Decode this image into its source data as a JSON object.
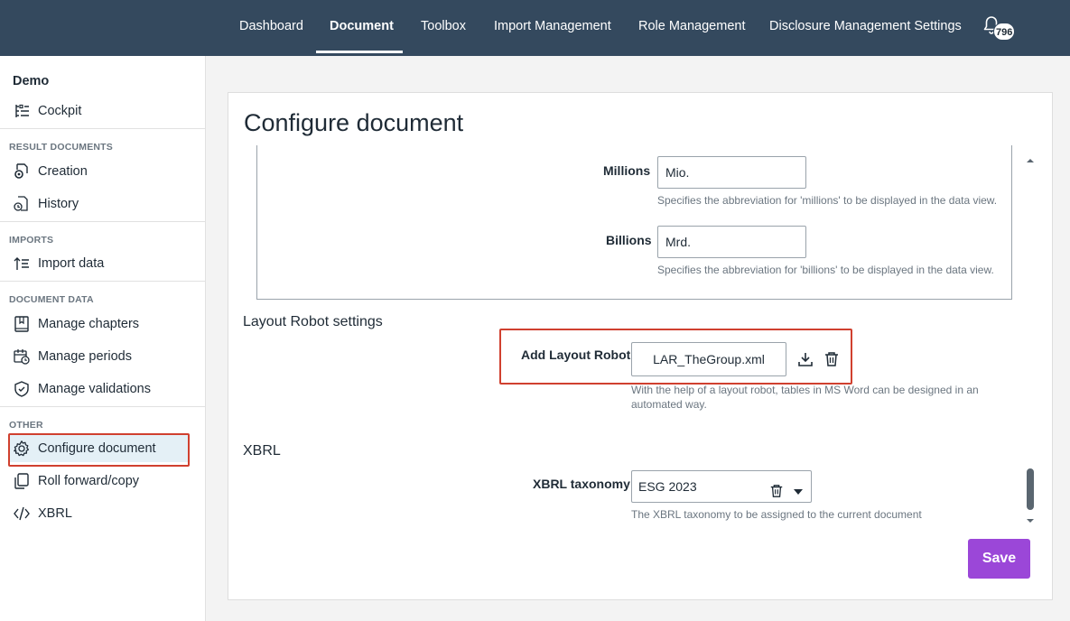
{
  "nav": {
    "items": [
      "Dashboard",
      "Document",
      "Toolbox",
      "Import Management",
      "Role Management",
      "Disclosure Management Settings"
    ],
    "active": "Document",
    "notification_count": "796"
  },
  "sidebar": {
    "project": "Demo",
    "cockpit": "Cockpit",
    "sections": {
      "result_documents": "RESULT DOCUMENTS",
      "imports": "IMPORTS",
      "document_data": "DOCUMENT DATA",
      "other": "OTHER"
    },
    "items": {
      "creation": "Creation",
      "history": "History",
      "import_data": "Import data",
      "manage_chapters": "Manage chapters",
      "manage_periods": "Manage periods",
      "manage_validations": "Manage validations",
      "configure_document": "Configure document",
      "roll_forward": "Roll forward/copy",
      "xbrl": "XBRL"
    },
    "active_item": "Configure document"
  },
  "main": {
    "title": "Configure document",
    "millions": {
      "label": "Millions",
      "value": "Mio.",
      "help": "Specifies the abbreviation for 'millions' to be displayed in the data view."
    },
    "billions": {
      "label": "Billions",
      "value": "Mrd.",
      "help": "Specifies the abbreviation for 'billions' to be displayed in the data view."
    },
    "layout_robot": {
      "section_title": "Layout Robot settings",
      "label": "Add Layout Robot",
      "file": "LAR_TheGroup.xml",
      "help_line1": "With the help of a layout robot, tables in MS Word can be designed in an",
      "help_line2": "automated way."
    },
    "xbrl": {
      "section_title": "XBRL",
      "label": "XBRL taxonomy",
      "value": "ESG 2023",
      "help": "The XBRL taxonomy to be assigned to the current document"
    },
    "save_label": "Save"
  },
  "colors": {
    "topbar": "#34495e",
    "accent": "#9b47d8",
    "highlight": "#d0402f"
  }
}
